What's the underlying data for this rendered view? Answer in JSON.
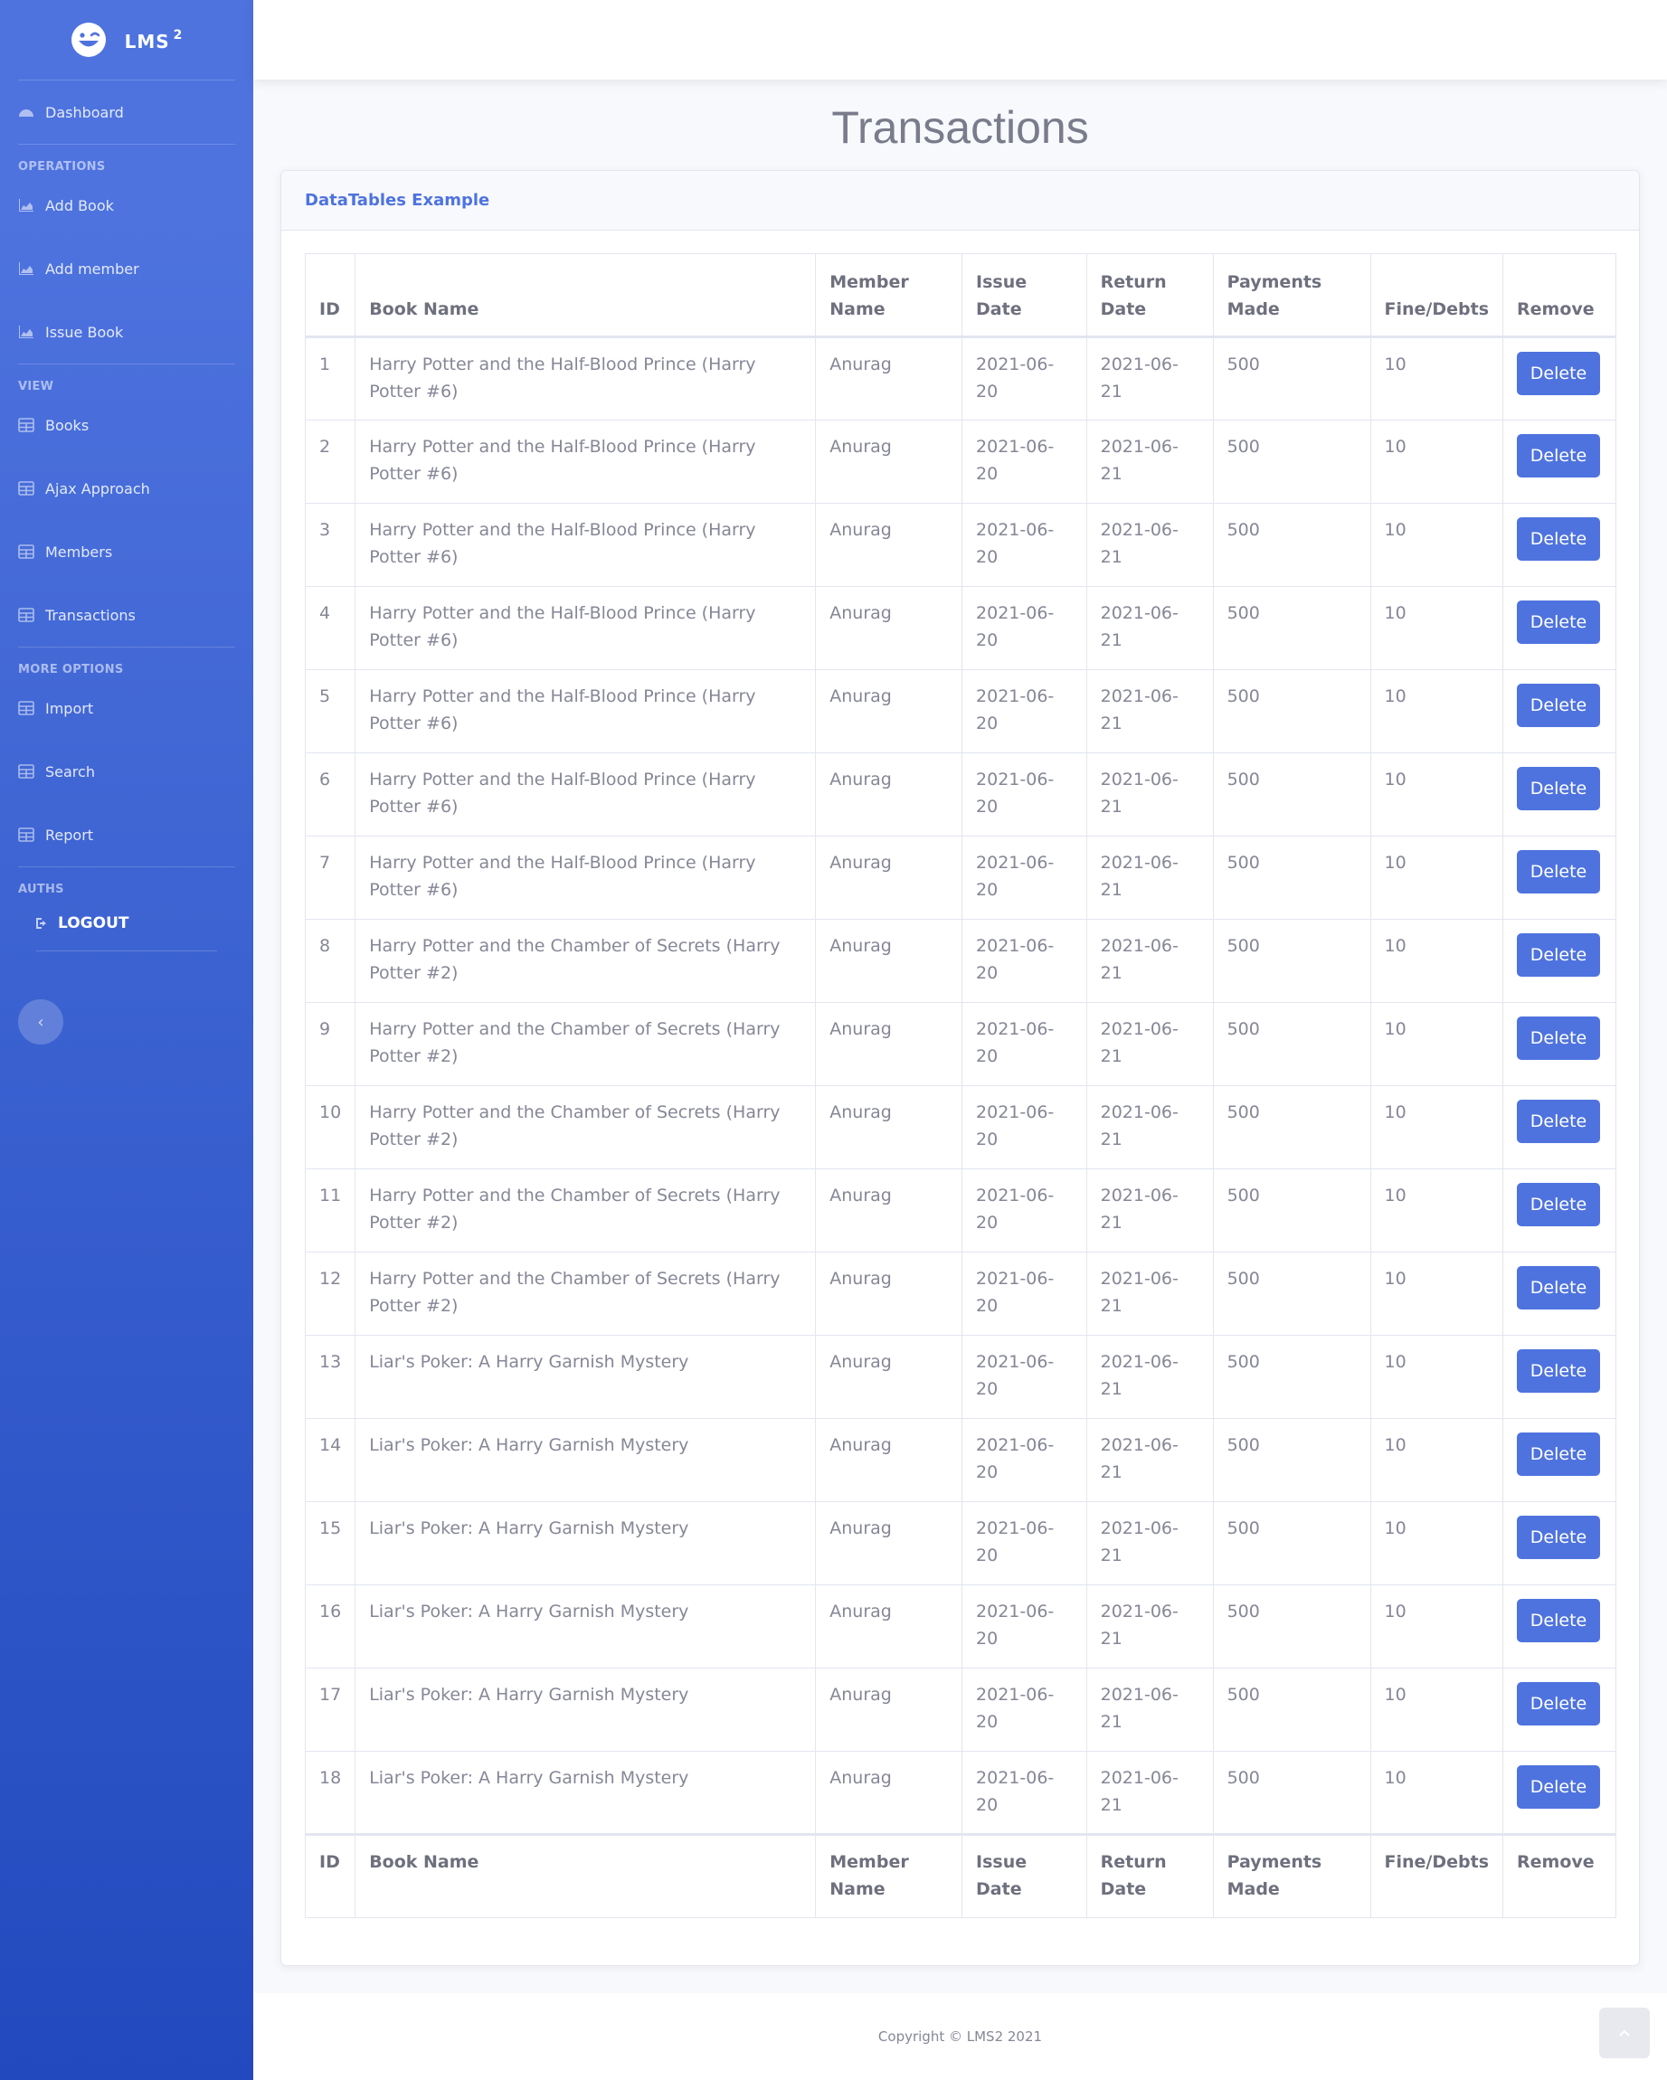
{
  "brand": {
    "name": "LMS",
    "sup": "2"
  },
  "sidebar": {
    "dashboard": "Dashboard",
    "headings": {
      "operations": "OPERATIONS",
      "view": "VIEW",
      "more": "MORE OPTIONS",
      "auths": "AUTHS"
    },
    "operations": [
      {
        "label": "Add Book",
        "icon": "chart-area-icon"
      },
      {
        "label": "Add member",
        "icon": "chart-area-icon"
      },
      {
        "label": "Issue Book",
        "icon": "chart-area-icon"
      }
    ],
    "view": [
      {
        "label": "Books",
        "icon": "table-icon"
      },
      {
        "label": "Ajax Approach",
        "icon": "table-icon"
      },
      {
        "label": "Members",
        "icon": "table-icon"
      },
      {
        "label": "Transactions",
        "icon": "table-icon"
      }
    ],
    "more": [
      {
        "label": "Import",
        "icon": "table-icon"
      },
      {
        "label": "Search",
        "icon": "table-icon"
      },
      {
        "label": "Report",
        "icon": "table-icon"
      }
    ],
    "logout": "LOGOUT",
    "toggle": "‹"
  },
  "main": {
    "title": "Transactions",
    "card_title": "DataTables Example",
    "columns": [
      "ID",
      "Book Name",
      "Member Name",
      "Issue Date",
      "Return Date",
      "Payments Made",
      "Fine/Debts",
      "Remove"
    ],
    "delete_label": "Delete",
    "rows": [
      [
        "1",
        "Harry Potter and the Half-Blood Prince (Harry Potter #6)",
        "Anurag",
        "2021-06-20",
        "2021-06-21",
        "500",
        "10"
      ],
      [
        "2",
        "Harry Potter and the Half-Blood Prince (Harry Potter #6)",
        "Anurag",
        "2021-06-20",
        "2021-06-21",
        "500",
        "10"
      ],
      [
        "3",
        "Harry Potter and the Half-Blood Prince (Harry Potter #6)",
        "Anurag",
        "2021-06-20",
        "2021-06-21",
        "500",
        "10"
      ],
      [
        "4",
        "Harry Potter and the Half-Blood Prince (Harry Potter #6)",
        "Anurag",
        "2021-06-20",
        "2021-06-21",
        "500",
        "10"
      ],
      [
        "5",
        "Harry Potter and the Half-Blood Prince (Harry Potter #6)",
        "Anurag",
        "2021-06-20",
        "2021-06-21",
        "500",
        "10"
      ],
      [
        "6",
        "Harry Potter and the Half-Blood Prince (Harry Potter #6)",
        "Anurag",
        "2021-06-20",
        "2021-06-21",
        "500",
        "10"
      ],
      [
        "7",
        "Harry Potter and the Half-Blood Prince (Harry Potter #6)",
        "Anurag",
        "2021-06-20",
        "2021-06-21",
        "500",
        "10"
      ],
      [
        "8",
        "Harry Potter and the Chamber of Secrets (Harry Potter #2)",
        "Anurag",
        "2021-06-20",
        "2021-06-21",
        "500",
        "10"
      ],
      [
        "9",
        "Harry Potter and the Chamber of Secrets (Harry Potter #2)",
        "Anurag",
        "2021-06-20",
        "2021-06-21",
        "500",
        "10"
      ],
      [
        "10",
        "Harry Potter and the Chamber of Secrets (Harry Potter #2)",
        "Anurag",
        "2021-06-20",
        "2021-06-21",
        "500",
        "10"
      ],
      [
        "11",
        "Harry Potter and the Chamber of Secrets (Harry Potter #2)",
        "Anurag",
        "2021-06-20",
        "2021-06-21",
        "500",
        "10"
      ],
      [
        "12",
        "Harry Potter and the Chamber of Secrets (Harry Potter #2)",
        "Anurag",
        "2021-06-20",
        "2021-06-21",
        "500",
        "10"
      ],
      [
        "13",
        "Liar's Poker: A Harry Garnish Mystery",
        "Anurag",
        "2021-06-20",
        "2021-06-21",
        "500",
        "10"
      ],
      [
        "14",
        "Liar's Poker: A Harry Garnish Mystery",
        "Anurag",
        "2021-06-20",
        "2021-06-21",
        "500",
        "10"
      ],
      [
        "15",
        "Liar's Poker: A Harry Garnish Mystery",
        "Anurag",
        "2021-06-20",
        "2021-06-21",
        "500",
        "10"
      ],
      [
        "16",
        "Liar's Poker: A Harry Garnish Mystery",
        "Anurag",
        "2021-06-20",
        "2021-06-21",
        "500",
        "10"
      ],
      [
        "17",
        "Liar's Poker: A Harry Garnish Mystery",
        "Anurag",
        "2021-06-20",
        "2021-06-21",
        "500",
        "10"
      ],
      [
        "18",
        "Liar's Poker: A Harry Garnish Mystery",
        "Anurag",
        "2021-06-20",
        "2021-06-21",
        "500",
        "10"
      ]
    ]
  },
  "footer": {
    "copyright": "Copyright © LMS2 2021"
  },
  "colors": {
    "primary": "#4e73df",
    "sidebar_end": "#224abe",
    "text": "#858796"
  }
}
